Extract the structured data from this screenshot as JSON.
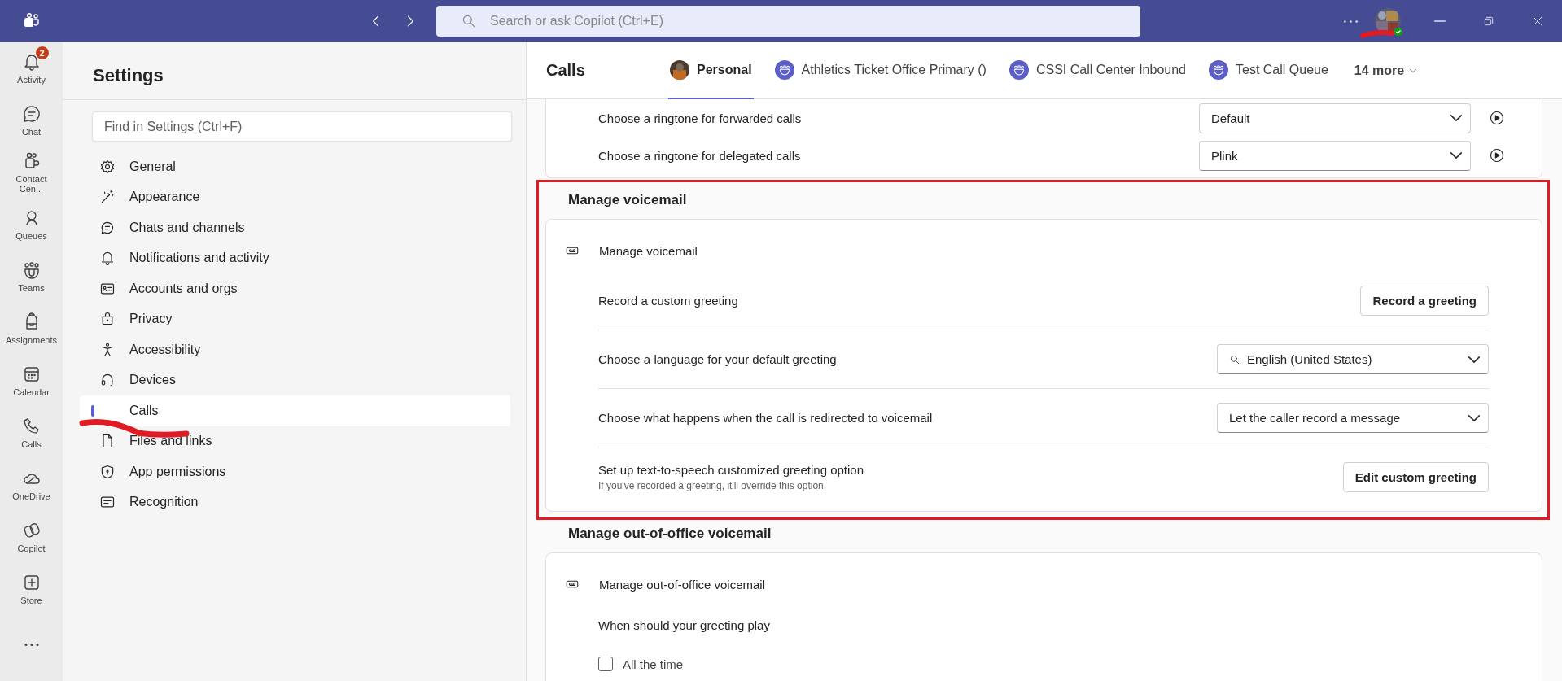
{
  "app_bar": {
    "search": {
      "placeholder": "Search or ask Copilot (Ctrl+E)"
    }
  },
  "rail": [
    {
      "label": "Activity",
      "badge": "2"
    },
    {
      "label": "Chat"
    },
    {
      "label": "Contact Cen..."
    },
    {
      "label": "Queues"
    },
    {
      "label": "Teams"
    },
    {
      "label": "Assignments"
    },
    {
      "label": "Calendar"
    },
    {
      "label": "Calls"
    },
    {
      "label": "OneDrive"
    },
    {
      "label": "Copilot"
    },
    {
      "label": "Store"
    }
  ],
  "settings": {
    "title": "Settings",
    "search": {
      "placeholder": "Find in Settings (Ctrl+F)"
    },
    "items": [
      {
        "label": "General",
        "selected": false
      },
      {
        "label": "Appearance",
        "selected": false
      },
      {
        "label": "Chats and channels",
        "selected": false
      },
      {
        "label": "Notifications and activity",
        "selected": false
      },
      {
        "label": "Accounts and orgs",
        "selected": false
      },
      {
        "label": "Privacy",
        "selected": false
      },
      {
        "label": "Accessibility",
        "selected": false
      },
      {
        "label": "Devices",
        "selected": false
      },
      {
        "label": "Calls",
        "selected": true
      },
      {
        "label": "Files and links",
        "selected": false
      },
      {
        "label": "App permissions",
        "selected": false
      },
      {
        "label": "Recognition",
        "selected": false
      }
    ]
  },
  "calls": {
    "title": "Calls",
    "tabs": [
      {
        "label": "Personal",
        "kind": "person",
        "selected": true
      },
      {
        "label": "Athletics Ticket Office Primary ()",
        "kind": "queue",
        "selected": false
      },
      {
        "label": "CSSI Call Center Inbound",
        "kind": "queue",
        "selected": false
      },
      {
        "label": "Test Call Queue",
        "kind": "queue",
        "selected": false
      }
    ],
    "more": "14 more"
  },
  "sections": [
    {
      "rows": [
        {
          "kind": "ringtone",
          "label": "Choose a ringtone for forwarded calls",
          "value": "Default"
        },
        {
          "kind": "ringtone",
          "label": "Choose a ringtone for delegated calls",
          "value": "Plink"
        }
      ]
    },
    {
      "heading": "Manage voicemail",
      "title": "Manage voicemail",
      "rows": [
        {
          "kind": "button",
          "label": "Record a custom greeting",
          "button": "Record a greeting"
        },
        {
          "kind": "search_dropdown",
          "label": "Choose a language for your default greeting",
          "value": "English (United States)"
        },
        {
          "kind": "dropdown",
          "label": "Choose what happens when the call is redirected to voicemail",
          "value": "Let the caller record a message"
        },
        {
          "kind": "button",
          "label": "Set up text-to-speech customized greeting option",
          "hint": "If you've recorded a greeting, it'll override this option.",
          "button": "Edit custom greeting"
        }
      ]
    },
    {
      "heading": "Manage out-of-office voicemail",
      "title": "Manage out-of-office voicemail",
      "rows": [
        {
          "kind": "text",
          "label": "When should your greeting play"
        },
        {
          "kind": "checkbox",
          "label": "All the time",
          "checked": false
        }
      ]
    }
  ]
}
